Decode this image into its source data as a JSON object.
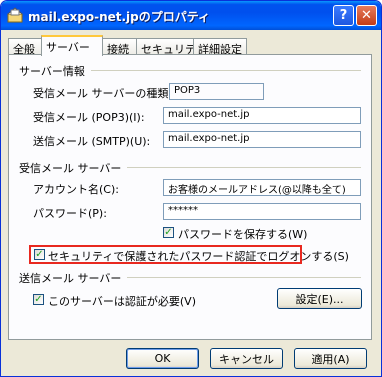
{
  "window": {
    "title": "mail.expo-net.jpのプロパティ",
    "help": "?",
    "close": "✕"
  },
  "tabs": [
    "全般",
    "サーバー",
    "接続",
    "セキュリティ",
    "詳細設定"
  ],
  "server_info": {
    "heading": "サーバー情報",
    "type_label": "受信メール サーバーの種類(M):",
    "type_value": "POP3",
    "incoming_label": "受信メール (POP3)(I):",
    "incoming_value": "mail.expo-net.jp",
    "outgoing_label": "送信メール (SMTP)(U):",
    "outgoing_value": "mail.expo-net.jp"
  },
  "incoming_server": {
    "heading": "受信メール サーバー",
    "account_label": "アカウント名(C):",
    "account_value": "お客様のメールアドレス(@以降も全て)",
    "password_label": "パスワード(P):",
    "password_value": "******",
    "save_password_label": "パスワードを保存する(W)",
    "spa_label": "セキュリティで保護されたパスワード認証でログオンする(S)"
  },
  "outgoing_server": {
    "heading": "送信メール サーバー",
    "auth_label": "このサーバーは認証が必要(V)",
    "settings_button": "設定(E)..."
  },
  "buttons": {
    "ok": "OK",
    "cancel": "キャンセル",
    "apply": "適用(A)"
  },
  "colors": {
    "title_bar": "#0054e3",
    "highlight_box": "#e8281f",
    "check": "#21a121"
  }
}
